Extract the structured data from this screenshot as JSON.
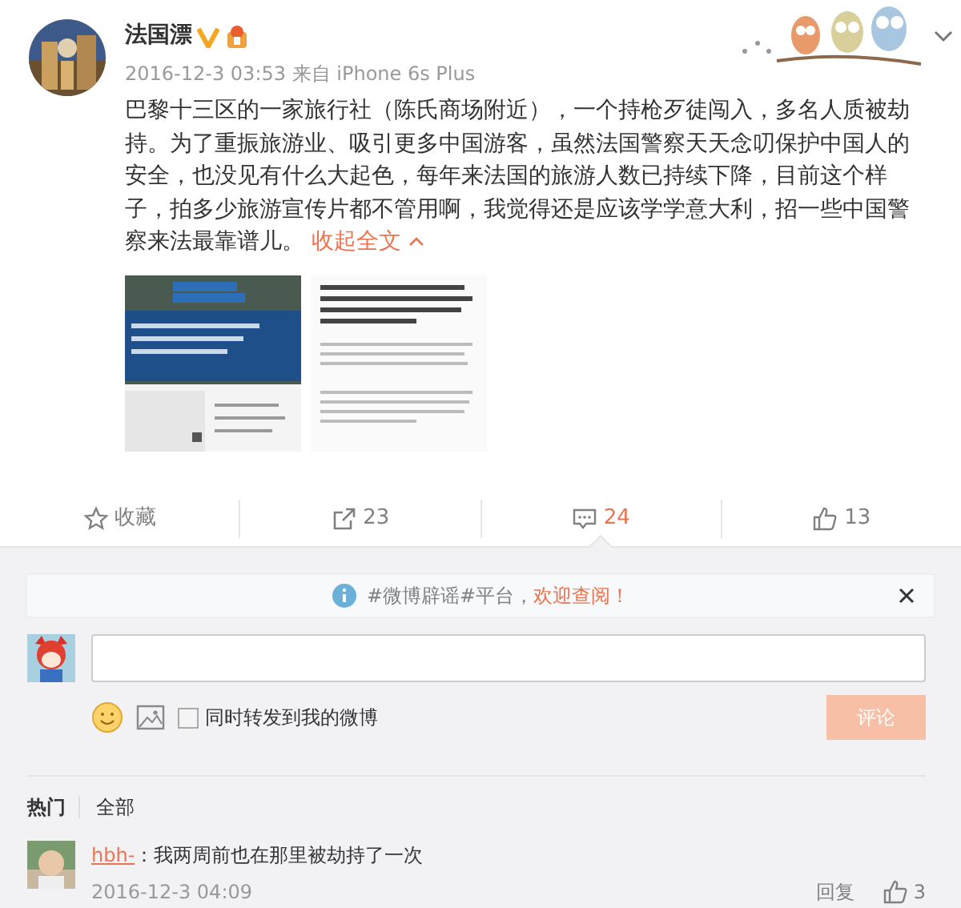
{
  "post": {
    "author": "法国漂",
    "verified": true,
    "timestamp": "2016-12-3 03:53",
    "source_prefix": "来自",
    "source": "iPhone 6s Plus",
    "text": "巴黎十三区的一家旅行社（陈氏商场附近），一个持枪歹徒闯入，多名人质被劫持。为了重振旅游业、吸引更多中国游客，虽然法国警察天天念叨保护中国人的安全，也没见有什么大起色，每年来法国的旅游人数已持续下降，目前这个样子，拍多少旅游宣传片都不管用啊，我觉得还是应该学学意大利，招一些中国警察来法最靠谱儿。",
    "collapse_link": "收起全文"
  },
  "actions": [
    {
      "kind": "favorite",
      "label": "收藏",
      "selected": false
    },
    {
      "kind": "repost",
      "label": "23",
      "selected": false
    },
    {
      "kind": "comment",
      "label": "24",
      "selected": true
    },
    {
      "kind": "like",
      "label": "13",
      "selected": false
    }
  ],
  "notice": {
    "text": "#微博辟谣#平台，",
    "link": "欢迎查阅！"
  },
  "composer": {
    "repost_option": {
      "label": "同时转发到我的微博",
      "checked": false
    },
    "submit": "评论",
    "submit_disabled": true
  },
  "comment_tabs": [
    {
      "label": "热门",
      "selected": true
    },
    {
      "label": "全部",
      "selected": false
    }
  ],
  "comments": [
    {
      "author": "hbh-",
      "separator": "：",
      "text": "我两周前也在那里被劫持了一次",
      "timestamp": "2016-12-3 04:09",
      "reply": "回复",
      "likes": "3"
    }
  ]
}
